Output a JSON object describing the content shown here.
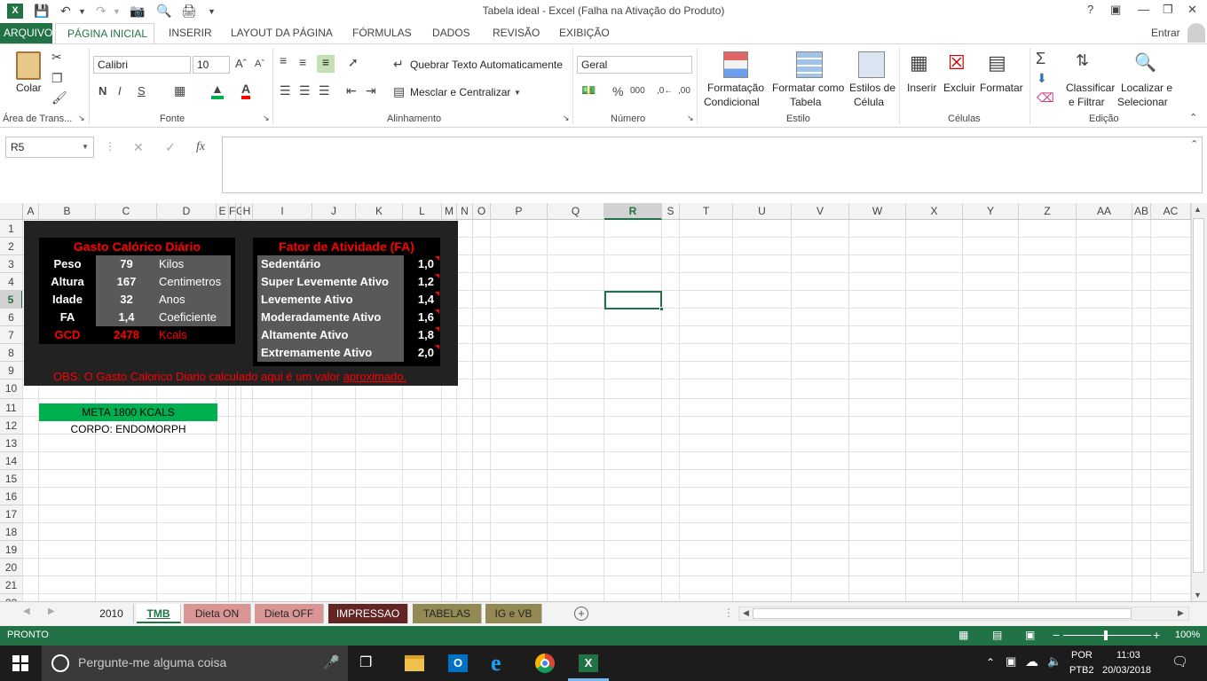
{
  "window": {
    "title": "Tabela ideal - Excel (Falha na Ativação do Produto)",
    "help": "?",
    "signin": "Entrar"
  },
  "ribbon_tabs": [
    "ARQUIVO",
    "PÁGINA INICIAL",
    "INSERIR",
    "LAYOUT DA PÁGINA",
    "FÓRMULAS",
    "DADOS",
    "REVISÃO",
    "EXIBIÇÃO"
  ],
  "ribbon": {
    "paste": "Colar",
    "clipboard": "Área de Trans...",
    "font_name": "Calibri",
    "font_size": "10",
    "font_group": "Fonte",
    "bold": "N",
    "italic": "I",
    "underline": "S",
    "wrap_text": "Quebrar Texto Automaticamente",
    "merge_center": "Mesclar e Centralizar",
    "align_group": "Alinhamento",
    "number_format": "Geral",
    "number_group": "Número",
    "cond_format_1": "Formatação",
    "cond_format_2": "Condicional",
    "format_table_1": "Formatar como",
    "format_table_2": "Tabela",
    "cell_styles_1": "Estilos de",
    "cell_styles_2": "Célula",
    "style_group": "Estilo",
    "insert": "Inserir",
    "delete": "Excluir",
    "format": "Formatar",
    "cells_group": "Células",
    "sort_1": "Classificar",
    "sort_2": "e Filtrar",
    "find_1": "Localizar e",
    "find_2": "Selecionar",
    "edit_group": "Edição"
  },
  "formula_bar": {
    "name_box": "R5",
    "fx": "fx",
    "content": ""
  },
  "columns": [
    "A",
    "B",
    "C",
    "D",
    "E",
    "F",
    "G",
    "H",
    "I",
    "J",
    "K",
    "L",
    "M",
    "N",
    "O",
    "P",
    "Q",
    "R",
    "S",
    "T",
    "U",
    "V",
    "W",
    "X",
    "Y",
    "Z",
    "AA",
    "AB",
    "AC"
  ],
  "rows": [
    "1",
    "2",
    "3",
    "4",
    "5",
    "6",
    "7",
    "8",
    "9",
    "10",
    "11",
    "12",
    "13",
    "14",
    "15",
    "16",
    "17",
    "18",
    "19",
    "20",
    "21",
    "22"
  ],
  "sheet": {
    "gcd_title": "Gasto Calórico Diário",
    "gcd_rows": [
      {
        "label": "Peso",
        "value": "79",
        "unit": "Kilos"
      },
      {
        "label": "Altura",
        "value": "167",
        "unit": "Centimetros"
      },
      {
        "label": "Idade",
        "value": "32",
        "unit": "Anos"
      },
      {
        "label": "FA",
        "value": "1,4",
        "unit": "Coeficiente"
      },
      {
        "label": "GCD",
        "value": "2478",
        "unit": "Kcals"
      }
    ],
    "fa_title": "Fator de Atividade (FA)",
    "fa_rows": [
      {
        "label": "Sedentário",
        "value": "1,0"
      },
      {
        "label": "Super Levemente Ativo",
        "value": "1,2"
      },
      {
        "label": "Levemente Ativo",
        "value": "1,4"
      },
      {
        "label": "Moderadamente Ativo",
        "value": "1,6"
      },
      {
        "label": "Altamente Ativo",
        "value": "1,8"
      },
      {
        "label": "Extremamente Ativo",
        "value": "2,0"
      }
    ],
    "obs_prefix": "OBS: O Gasto Calorico Diario calculado aqui é um valor ",
    "obs_link": "aproximado.",
    "meta": "META  1800 KCALS",
    "corpo": "CORPO: ENDOMORPH"
  },
  "sheet_tabs": [
    {
      "label": "2010",
      "color": "#f3f3f3",
      "fg": "#262626"
    },
    {
      "label": "TMB",
      "color": "#ffffff",
      "fg": "#217346"
    },
    {
      "label": "Dieta ON",
      "color": "#d99694",
      "fg": "#262626"
    },
    {
      "label": "Dieta OFF",
      "color": "#d99694",
      "fg": "#262626"
    },
    {
      "label": "IMPRESSAO",
      "color": "#632523",
      "fg": "#ffffff"
    },
    {
      "label": "TABELAS",
      "color": "#938953",
      "fg": "#262626"
    },
    {
      "label": "IG e VB",
      "color": "#938953",
      "fg": "#262626"
    }
  ],
  "status": {
    "mode": "PRONTO",
    "zoom": "100%"
  },
  "taskbar": {
    "search": "Pergunte-me alguma coisa",
    "lang1": "POR",
    "lang2": "PTB2",
    "time": "11:03",
    "date": "20/03/2018"
  },
  "colors": {
    "excel_green": "#217346",
    "panel_black": "#222222",
    "cell_gray": "#595959",
    "red": "#ff0000",
    "meta_green": "#00b050"
  }
}
